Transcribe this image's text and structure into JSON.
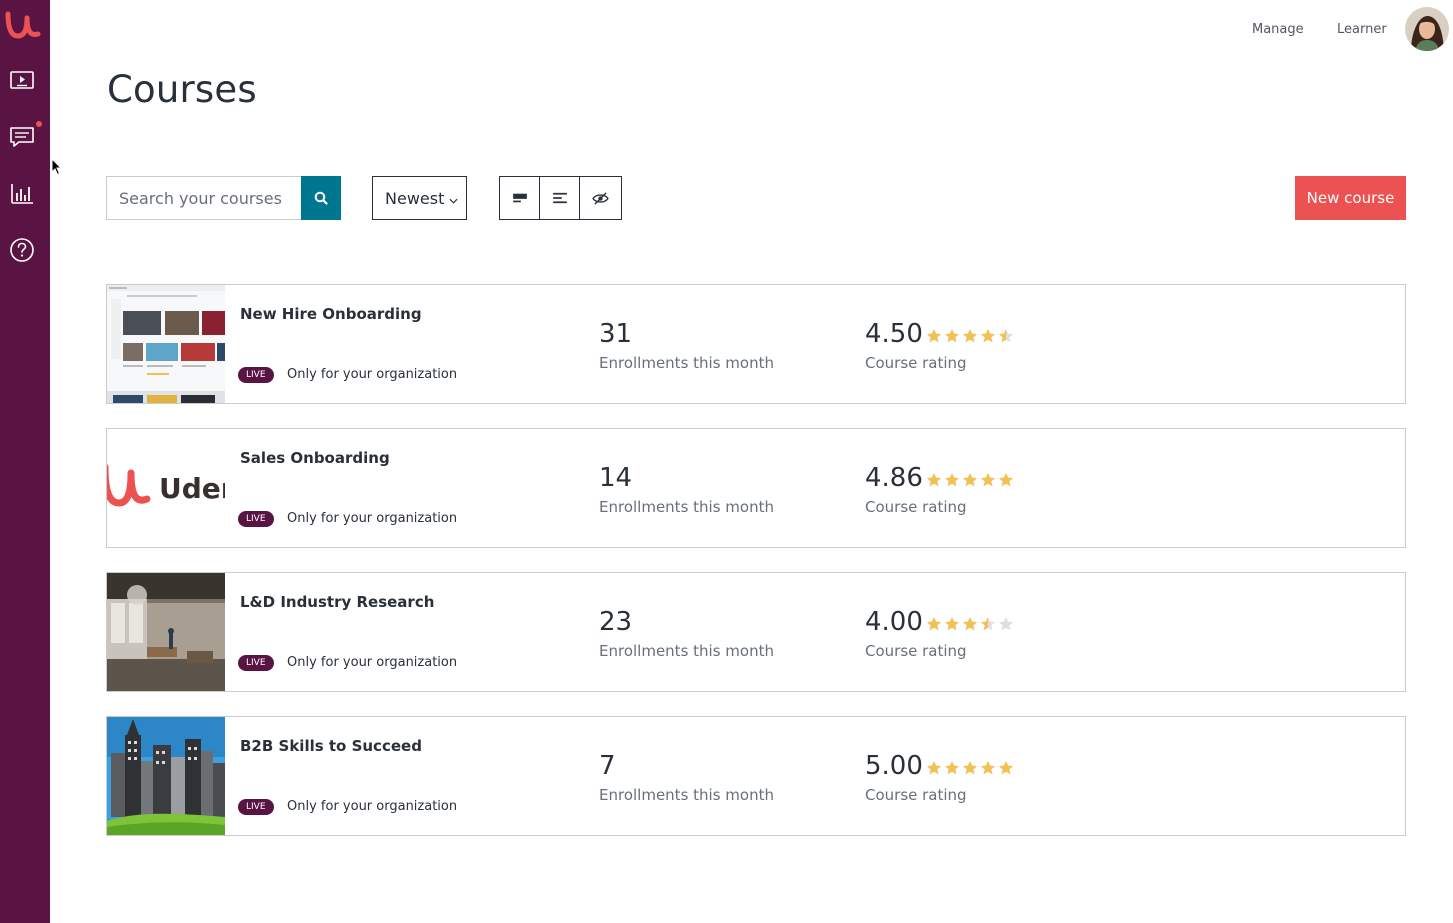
{
  "sidebar": {
    "items": [
      {
        "icon": "course-player-icon"
      },
      {
        "icon": "messages-icon",
        "notification": true
      },
      {
        "icon": "analytics-icon"
      },
      {
        "icon": "help-icon"
      }
    ]
  },
  "topnav": {
    "manage_label": "Manage",
    "learner_label": "Learner"
  },
  "page": {
    "title": "Courses"
  },
  "toolbar": {
    "search_placeholder": "Search your courses",
    "sort_value": "Newest",
    "new_course_label": "New course"
  },
  "courses": [
    {
      "title": "New Hire Onboarding",
      "status": "LIVE",
      "visibility": "Only for your organization",
      "enrollments": "31",
      "enrollments_label": "Enrollments this month",
      "rating": "4.50",
      "rating_value": 4.5,
      "rating_label": "Course rating"
    },
    {
      "title": "Sales Onboarding",
      "status": "LIVE",
      "visibility": "Only for your organization",
      "enrollments": "14",
      "enrollments_label": "Enrollments this month",
      "rating": "4.86",
      "rating_value": 5,
      "rating_label": "Course rating",
      "thumb_text": "Uder"
    },
    {
      "title": "L&D Industry Research",
      "status": "LIVE",
      "visibility": "Only for your organization",
      "enrollments": "23",
      "enrollments_label": "Enrollments this month",
      "rating": "4.00",
      "rating_value": 3.5,
      "rating_label": "Course rating"
    },
    {
      "title": "B2B Skills to Succeed",
      "status": "LIVE",
      "visibility": "Only for your organization",
      "enrollments": "7",
      "enrollments_label": "Enrollments this month",
      "rating": "5.00",
      "rating_value": 5,
      "rating_label": "Course rating"
    }
  ],
  "colors": {
    "sidebar": "#5a1443",
    "accent_red": "#ec5252",
    "search_teal": "#007791",
    "star": "#f4c150",
    "star_empty": "#dedfe0"
  }
}
